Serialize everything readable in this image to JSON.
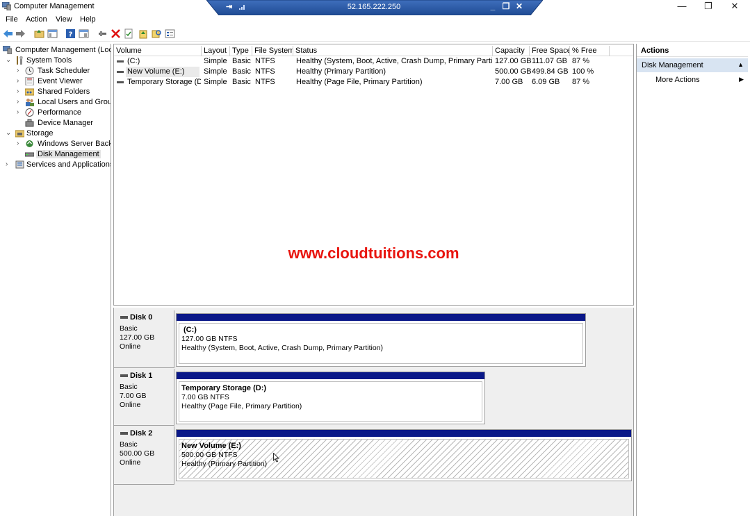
{
  "window": {
    "title": "Computer Management",
    "minimize": "—",
    "restore": "❐",
    "close": "✕"
  },
  "rdp": {
    "host": "52.165.222.250",
    "minimize": "_",
    "restore": "❐",
    "close": "✕",
    "pin": "⇥"
  },
  "menu": [
    "File",
    "Action",
    "View",
    "Help"
  ],
  "tree": {
    "root": "Computer Management (Local",
    "system_tools": "System Tools",
    "task_scheduler": "Task Scheduler",
    "event_viewer": "Event Viewer",
    "shared_folders": "Shared Folders",
    "local_users": "Local Users and Groups",
    "performance": "Performance",
    "device_manager": "Device Manager",
    "storage": "Storage",
    "wsb": "Windows Server Backup",
    "disk_management": "Disk Management",
    "services_apps": "Services and Applications"
  },
  "volume_list": {
    "headers": [
      "Volume",
      "Layout",
      "Type",
      "File System",
      "Status",
      "Capacity",
      "Free Space",
      "% Free"
    ],
    "rows": [
      [
        "(C:)",
        "Simple",
        "Basic",
        "NTFS",
        "Healthy (System, Boot, Active, Crash Dump, Primary Partition)",
        "127.00 GB",
        "111.07 GB",
        "87 %"
      ],
      [
        "New Volume (E:)",
        "Simple",
        "Basic",
        "NTFS",
        "Healthy (Primary Partition)",
        "500.00 GB",
        "499.84 GB",
        "100 %"
      ],
      [
        "Temporary Storage (D:)",
        "Simple",
        "Basic",
        "NTFS",
        "Healthy (Page File, Primary Partition)",
        "7.00 GB",
        "6.09 GB",
        "87 %"
      ]
    ]
  },
  "watermark": "www.cloudtuitions.com",
  "disks": [
    {
      "name": "Disk 0",
      "type": "Basic",
      "size": "127.00 GB",
      "state": "Online",
      "partition": {
        "label": "(C:)",
        "size": "127.00 GB NTFS",
        "status": "Healthy (System, Boot, Active, Crash Dump, Primary Partition)"
      }
    },
    {
      "name": "Disk 1",
      "type": "Basic",
      "size": "7.00 GB",
      "state": "Online",
      "partition": {
        "label": "Temporary Storage  (D:)",
        "size": "7.00 GB NTFS",
        "status": "Healthy (Page File, Primary Partition)"
      }
    },
    {
      "name": "Disk 2",
      "type": "Basic",
      "size": "500.00 GB",
      "state": "Online",
      "partition": {
        "label": "New Volume  (E:)",
        "size": "500.00 GB NTFS",
        "status": "Healthy (Primary Partition)"
      }
    }
  ],
  "actions": {
    "header": "Actions",
    "section": "Disk Management",
    "more": "More Actions"
  },
  "colors": {
    "partition_bar": "#0a1888",
    "watermark": "#e8150f",
    "rdp_bar": "#2a5aa6",
    "actions_section_bg": "#d8e4f2"
  }
}
